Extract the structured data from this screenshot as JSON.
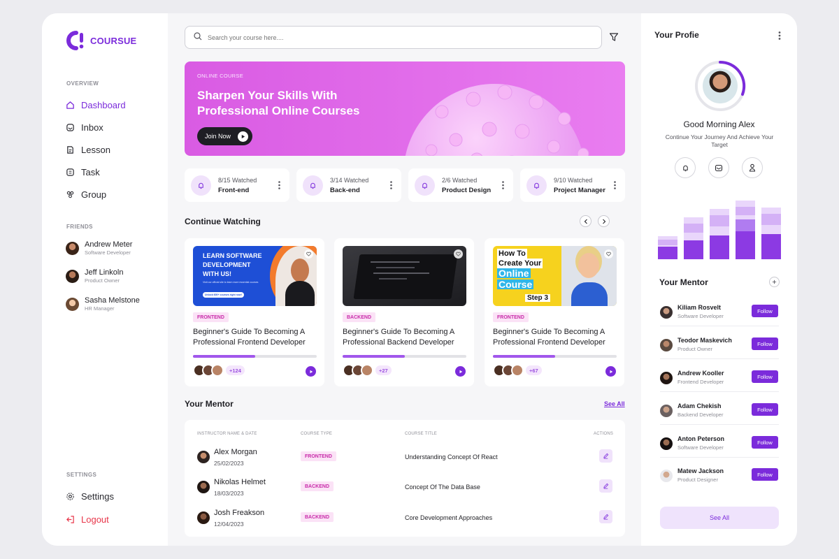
{
  "brand": {
    "name": "COURSUE",
    "accent": "#7b2bdb"
  },
  "sidebar": {
    "overview_label": "OVERVIEW",
    "nav": [
      {
        "label": "Dashboard",
        "icon": "home-icon",
        "active": true
      },
      {
        "label": "Inbox",
        "icon": "inbox-icon"
      },
      {
        "label": "Lesson",
        "icon": "book-icon"
      },
      {
        "label": "Task",
        "icon": "task-icon"
      },
      {
        "label": "Group",
        "icon": "group-icon"
      }
    ],
    "friends_label": "FRIENDS",
    "friends": [
      {
        "name": "Andrew Meter",
        "role": "Software Developer"
      },
      {
        "name": "Jeff Linkoln",
        "role": "Product Owner"
      },
      {
        "name": "Sasha Melstone",
        "role": "HR Manager"
      }
    ],
    "settings_label": "SETTINGS",
    "settings": "Settings",
    "logout": "Logout"
  },
  "search": {
    "placeholder": "Search your course here...."
  },
  "banner": {
    "tag": "ONLINE COURSE",
    "title": "Sharpen Your Skills With Professional Online Courses",
    "button": "Join Now"
  },
  "stats": [
    {
      "watched": "8/15 Watched",
      "category": "Front-end"
    },
    {
      "watched": "3/14 Watched",
      "category": "Back-end"
    },
    {
      "watched": "2/6 Watched",
      "category": "Product Design"
    },
    {
      "watched": "9/10 Watched",
      "category": "Project Manager"
    }
  ],
  "continue_watching": {
    "title": "Continue Watching",
    "courses": [
      {
        "badge": "FRONTEND",
        "title": "Beginner's Guide To Becoming A Professional Frontend Developer",
        "progress": 0.5,
        "count": "+124",
        "thumb_lines": [
          "LEARN SOFTWARE",
          "DEVELOPMENT",
          "WITH US!"
        ],
        "thumb_sub": "Visit our official site to learn more essential courses",
        "thumb_pill": "Unlock 600+ courses right now!"
      },
      {
        "badge": "BACKEND",
        "title": "Beginner's Guide To Becoming A Professional Backend Developer",
        "progress": 0.5,
        "count": "+27"
      },
      {
        "badge": "FRONTEND",
        "title": "Beginner's Guide To Becoming A Professional Frontend Developer",
        "progress": 0.5,
        "count": "+67",
        "thumb_lines": [
          "How To",
          "Create Your",
          "Online",
          "Course",
          "Step 3"
        ]
      }
    ]
  },
  "mentor_table": {
    "title": "Your Mentor",
    "see_all": "See All",
    "headers": [
      "INSTRUCTOR NAME & DATE",
      "COURSE TYPE",
      "COURSE TITLE",
      "ACTIONS"
    ],
    "rows": [
      {
        "name": "Alex Morgan",
        "date": "25/02/2023",
        "type": "FRONTEND",
        "title": "Understanding Concept Of React"
      },
      {
        "name": "Nikolas Helmet",
        "date": "18/03/2023",
        "type": "BACKEND",
        "title": "Concept Of The Data Base"
      },
      {
        "name": "Josh Freakson",
        "date": "12/04/2023",
        "type": "BACKEND",
        "title": "Core Development Approaches"
      }
    ]
  },
  "profile": {
    "title": "Your Profie",
    "greeting": "Good Morning Alex",
    "subtitle": "Continue Your Journey And Achieve Your Target",
    "icons": [
      "bell-icon",
      "message-icon",
      "user-icon"
    ]
  },
  "mentors": {
    "title": "Your Mentor",
    "follow": "Follow",
    "see_all": "See All",
    "list": [
      {
        "name": "Kiliam Rosvelt",
        "role": "Software Developer"
      },
      {
        "name": "Teodor Maskevich",
        "role": "Product Owner"
      },
      {
        "name": "Andrew Kooller",
        "role": "Frontend Developer"
      },
      {
        "name": "Adam Chekish",
        "role": "Backend Developer"
      },
      {
        "name": "Anton Peterson",
        "role": "Software Developer"
      },
      {
        "name": "Matew Jackson",
        "role": "Product Designer"
      }
    ]
  }
}
